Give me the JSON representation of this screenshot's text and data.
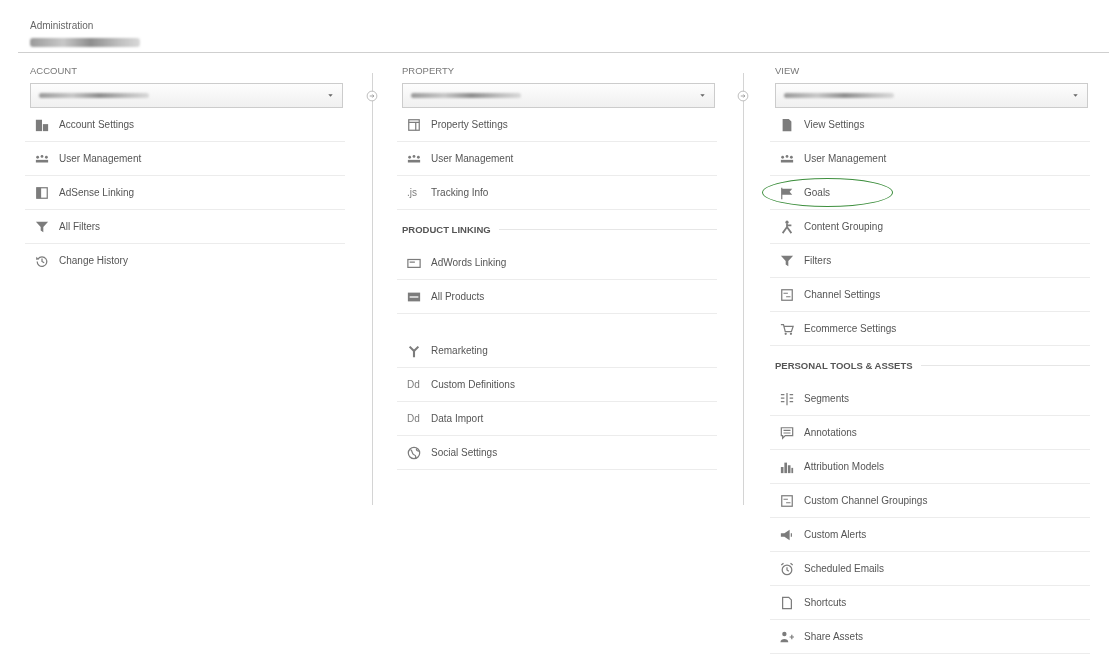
{
  "header": {
    "title": "Administration"
  },
  "columns": [
    {
      "label": "ACCOUNT",
      "groups": [
        {
          "items": [
            {
              "label": "Account Settings",
              "circled": false
            },
            {
              "label": "User Management",
              "circled": false
            },
            {
              "label": "AdSense Linking",
              "circled": false
            },
            {
              "label": "All Filters",
              "circled": false
            },
            {
              "label": "Change History",
              "circled": false
            }
          ]
        }
      ]
    },
    {
      "label": "PROPERTY",
      "groups": [
        {
          "items": [
            {
              "label": "Property Settings",
              "circled": false
            },
            {
              "label": "User Management",
              "circled": false
            },
            {
              "label": "Tracking Info",
              "glyph": ".js",
              "circled": false
            }
          ]
        },
        {
          "heading": "PRODUCT LINKING",
          "items": [
            {
              "label": "AdWords Linking",
              "circled": false
            },
            {
              "label": "All Products",
              "circled": false
            }
          ]
        },
        {
          "items": [
            {
              "label": "Remarketing",
              "circled": false
            },
            {
              "label": "Custom Definitions",
              "glyph": "Dd",
              "circled": false
            },
            {
              "label": "Data Import",
              "glyph": "Dd",
              "circled": false
            },
            {
              "label": "Social Settings",
              "circled": false
            }
          ]
        }
      ]
    },
    {
      "label": "VIEW",
      "groups": [
        {
          "items": [
            {
              "label": "View Settings",
              "circled": false
            },
            {
              "label": "User Management",
              "circled": false
            },
            {
              "label": "Goals",
              "circled": true
            },
            {
              "label": "Content Grouping",
              "circled": false
            },
            {
              "label": "Filters",
              "circled": false
            },
            {
              "label": "Channel Settings",
              "circled": false
            },
            {
              "label": "Ecommerce Settings",
              "circled": false
            }
          ]
        },
        {
          "heading": "PERSONAL TOOLS & ASSETS",
          "items": [
            {
              "label": "Segments",
              "circled": false
            },
            {
              "label": "Annotations",
              "circled": false
            },
            {
              "label": "Attribution Models",
              "circled": false
            },
            {
              "label": "Custom Channel Groupings",
              "circled": false
            },
            {
              "label": "Custom Alerts",
              "circled": false
            },
            {
              "label": "Scheduled Emails",
              "circled": false
            },
            {
              "label": "Shortcuts",
              "circled": false
            },
            {
              "label": "Share Assets",
              "circled": false
            }
          ]
        }
      ]
    }
  ]
}
